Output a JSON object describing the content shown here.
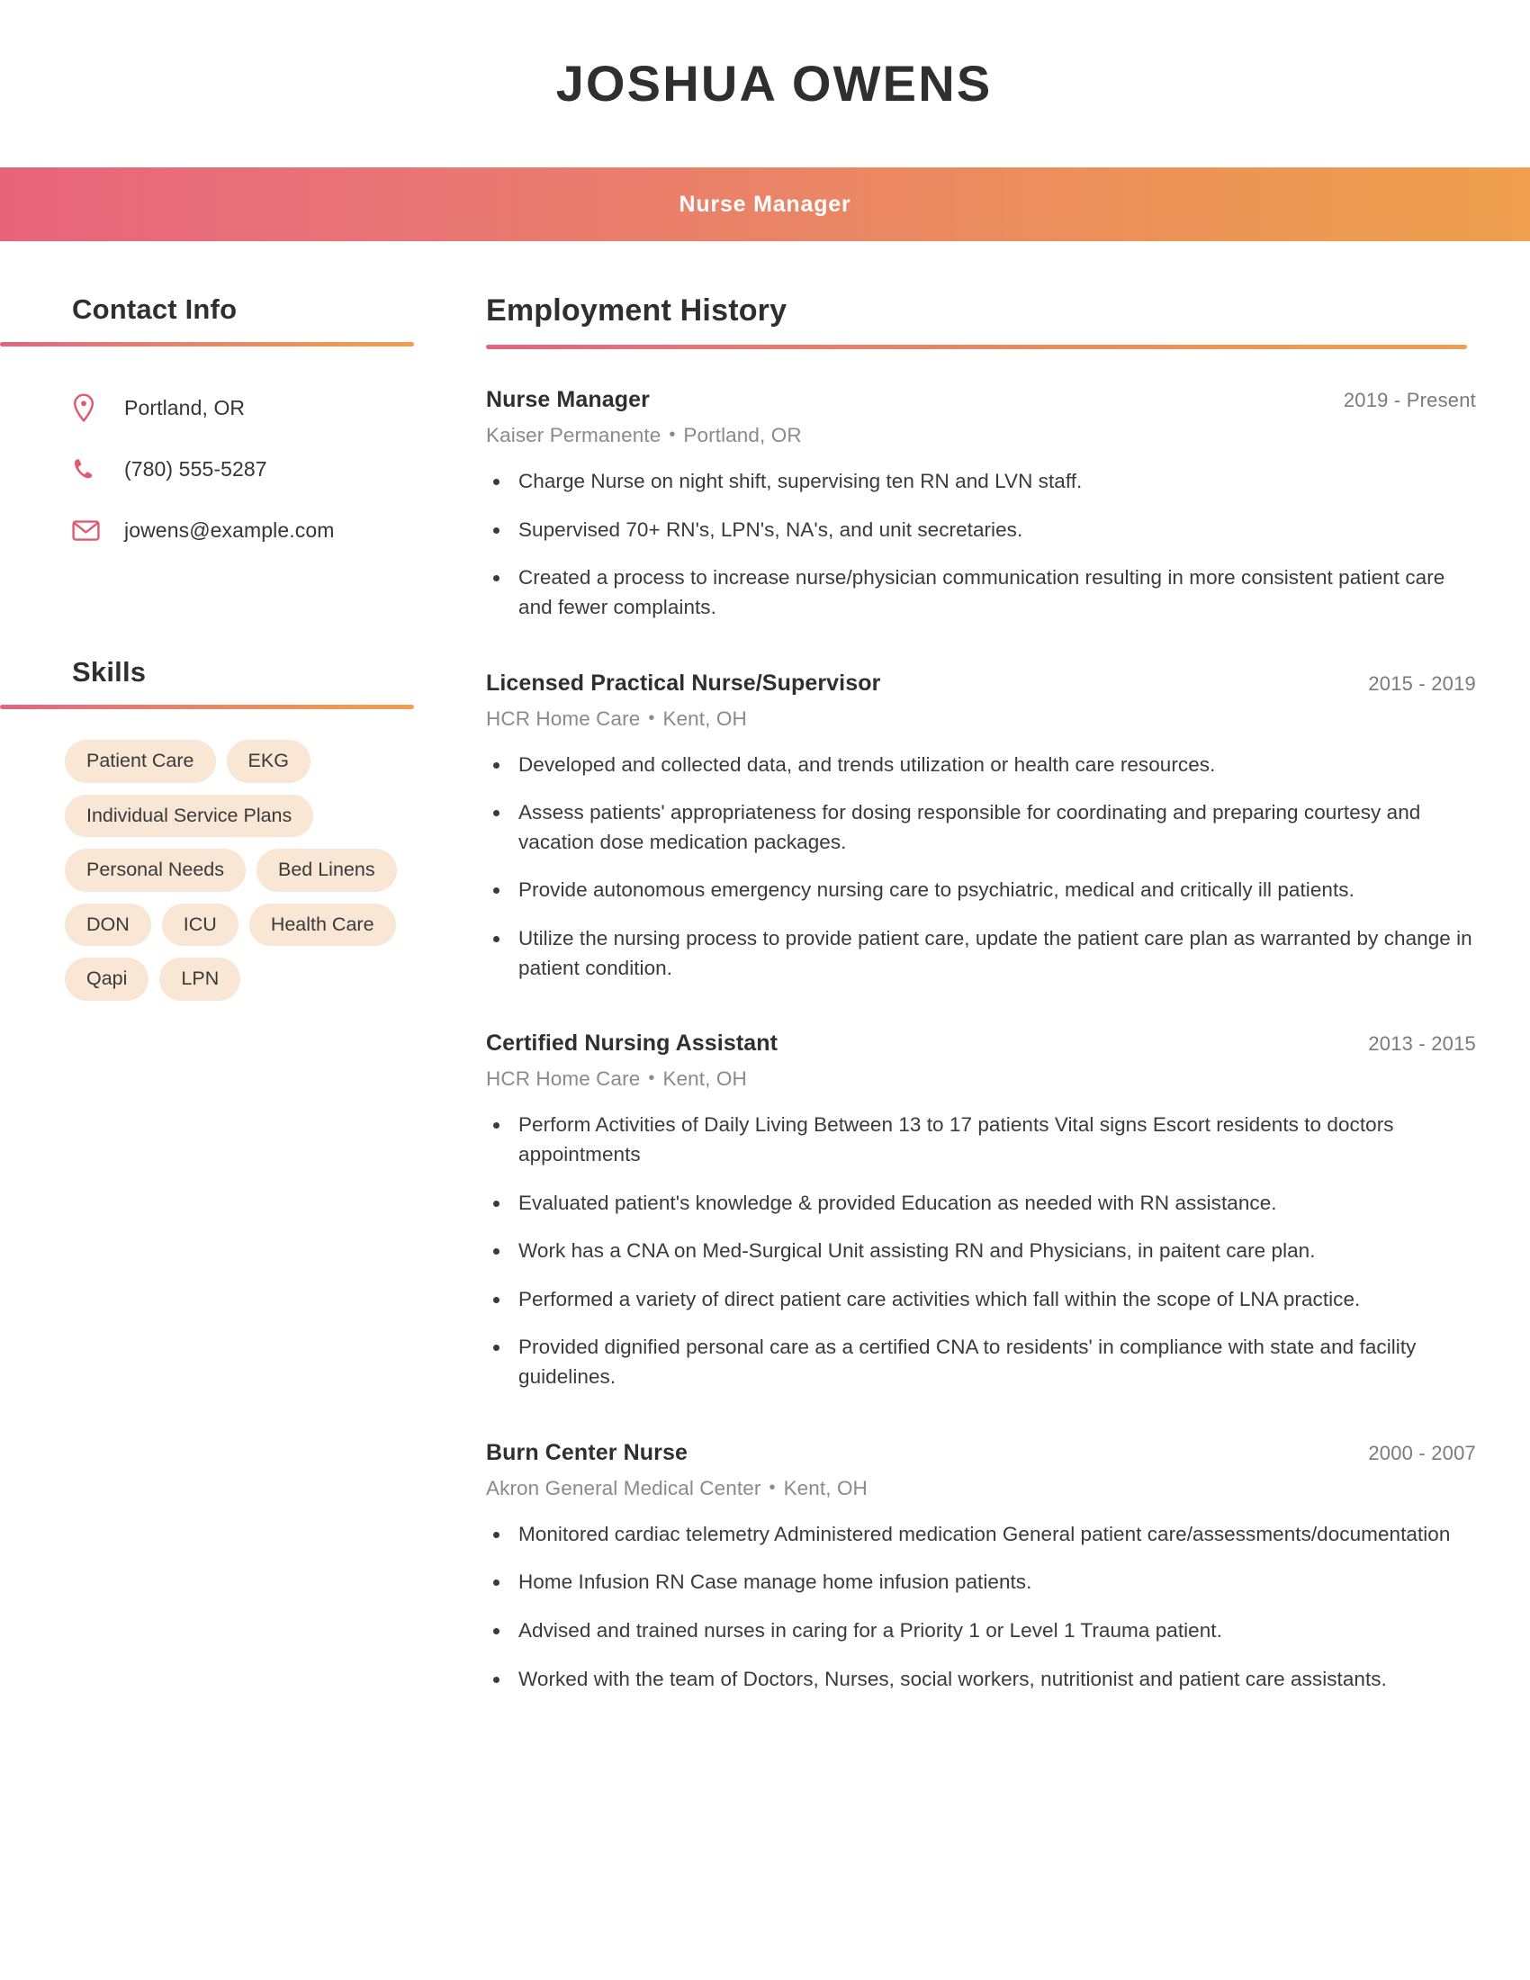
{
  "theme": {
    "gradient_start": "#e8647b",
    "gradient_end": "#ed9a52",
    "chip_background": "#f9e6d5",
    "icon_color": "#e2596e",
    "heading_color": "#2f2f2f",
    "muted_text": "#8a8a8a"
  },
  "header": {
    "name": "JOSHUA OWENS",
    "job_title": "Nurse Manager"
  },
  "sidebar": {
    "contact": {
      "heading": "Contact Info",
      "items": [
        {
          "icon": "location-pin-icon",
          "value": "Portland, OR"
        },
        {
          "icon": "phone-icon",
          "value": "(780) 555-5287"
        },
        {
          "icon": "envelope-icon",
          "value": "jowens@example.com"
        }
      ]
    },
    "skills": {
      "heading": "Skills",
      "items": [
        "Patient Care",
        "EKG",
        "Individual Service Plans",
        "Personal Needs",
        "Bed Linens",
        "DON",
        "ICU",
        "Health Care",
        "Qapi",
        "LPN"
      ]
    }
  },
  "main": {
    "employment": {
      "heading": "Employment History",
      "separator": "•",
      "jobs": [
        {
          "title": "Nurse Manager",
          "dates": "2019 - Present",
          "company": "Kaiser Permanente",
          "location": "Portland, OR",
          "bullets": [
            "Charge Nurse on night shift, supervising ten RN and LVN staff.",
            "Supervised 70+ RN's, LPN's, NA's, and unit secretaries.",
            "Created a process to increase nurse/physician communication resulting in more consistent patient care and fewer complaints."
          ]
        },
        {
          "title": "Licensed Practical Nurse/Supervisor",
          "dates": "2015 - 2019",
          "company": "HCR Home Care",
          "location": "Kent, OH",
          "bullets": [
            "Developed and collected data, and trends utilization or health care resources.",
            "Assess patients' appropriateness for dosing responsible for coordinating and preparing courtesy and vacation dose medication packages.",
            "Provide autonomous emergency nursing care to psychiatric, medical and critically ill patients.",
            "Utilize the nursing process to provide patient care, update the patient care plan as warranted by change in patient condition."
          ]
        },
        {
          "title": "Certified Nursing Assistant",
          "dates": "2013 - 2015",
          "company": "HCR Home Care",
          "location": "Kent, OH",
          "bullets": [
            "Perform Activities of Daily Living Between 13 to 17 patients Vital signs Escort residents to doctors appointments",
            "Evaluated patient's knowledge & provided Education as needed with RN assistance.",
            "Work has a CNA on Med-Surgical Unit assisting RN and Physicians, in paitent care plan.",
            "Performed a variety of direct patient care activities which fall within the scope of LNA practice.",
            "Provided dignified personal care as a certified CNA to residents' in compliance with state and facility guidelines."
          ]
        },
        {
          "title": "Burn Center Nurse",
          "dates": "2000 - 2007",
          "company": "Akron General Medical Center",
          "location": "Kent, OH",
          "bullets": [
            "Monitored cardiac telemetry Administered medication General patient care/assessments/documentation",
            "Home Infusion RN Case manage home infusion patients.",
            "Advised and trained nurses in caring for a Priority 1 or Level 1 Trauma patient.",
            "Worked with the team of Doctors, Nurses, social workers, nutritionist and patient care assistants."
          ]
        }
      ]
    }
  }
}
